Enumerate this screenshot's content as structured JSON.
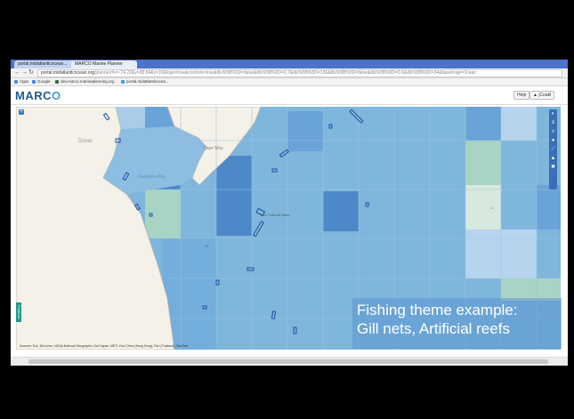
{
  "browser": {
    "tabs": [
      {
        "label": "portal.midatlanticocean...",
        "active": false
      },
      {
        "label": "MARCO Marine Planner",
        "active": true
      }
    ],
    "url_host": "portal.midatlanticocean.org",
    "url_rest": "/planner/#x=-74.22&y=38.84&z=10&logo=true&controls=true&dls%5B%5D=false&dls%5B%5D=0.7&dls%5B%5D=136&dls%5B%5D=false&dls%5B%5D=0.6&dls%5B%5D=34&basemap=Ocean",
    "bookmarks": [
      {
        "label": "Apps",
        "color": "#4a90d9"
      },
      {
        "label": "Google",
        "color": "#4285f4"
      },
      {
        "label": "dev.marco.marineplanning.org",
        "color": "#2d6e3e"
      },
      {
        "label": "portal.midatlanticocea...",
        "color": "#3f9fd6"
      }
    ]
  },
  "app": {
    "logo_main": "MARC",
    "logo_accent": "O",
    "help_label": "Help",
    "user_label": "▲ jCoakl"
  },
  "map": {
    "labels": {
      "dover": "Dover",
      "delaware_bay": "Delaware Bay",
      "cape_may": "Cape May",
      "offshore_label": "Five Fathom Bank",
      "grid_block_1": "18",
      "grid_block_2": "22"
    },
    "attribution": "Sources: Esri, DeLorme, NOAA National Geographic, Esri Japan, METI, Esri China (Hong Kong), Esri (Thailand), TomTom",
    "zoom_label": "+",
    "side_tab_label": "Feedback",
    "colors": {
      "ocean": "#7fb6db",
      "land": "#f4f1e8",
      "cell_dark": "#4d88c9",
      "cell_mid": "#6aa3d8",
      "cell_light": "#b7d4ee",
      "cell_green": "#a8d4c4",
      "cell_pale_green": "#d7e9dc",
      "reef_outline": "#1f4fa0"
    },
    "tool_icons": [
      "globe-icon",
      "layers-icon",
      "search-icon",
      "marker-icon",
      "measure-icon",
      "draw-icon",
      "print-icon"
    ]
  },
  "overlay": {
    "line1": "Fishing theme example:",
    "line2": "Gill nets, Artificial reefs"
  }
}
